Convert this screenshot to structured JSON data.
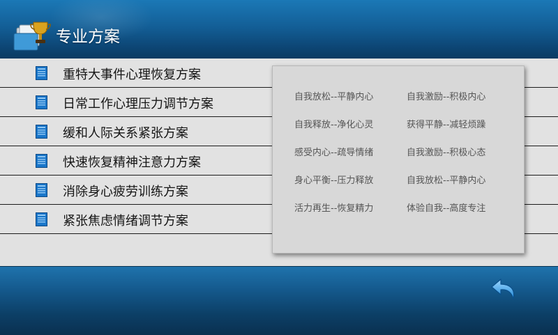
{
  "header": {
    "title": "专业方案",
    "icon": "trophy-folder-icon"
  },
  "plans": [
    {
      "label": "重特大事件心理恢复方案",
      "icon": "document-icon"
    },
    {
      "label": "日常工作心理压力调节方案",
      "icon": "document-icon"
    },
    {
      "label": "缓和人际关系紧张方案",
      "icon": "document-icon"
    },
    {
      "label": "快速恢复精神注意力方案",
      "icon": "document-icon"
    },
    {
      "label": "消除身心疲劳训练方案",
      "icon": "document-icon"
    },
    {
      "label": "紧张焦虑情绪调节方案",
      "icon": "document-icon"
    }
  ],
  "submenu": [
    [
      "自我放松--平静内心",
      "自我激励--积极内心"
    ],
    [
      "自我释放--净化心灵",
      "获得平静--减轻烦躁"
    ],
    [
      "感受内心--疏导情绪",
      "自我激励--积极心态"
    ],
    [
      "身心平衡--压力释放",
      "自我放松--平静内心"
    ],
    [
      "活力再生--恢复精力",
      "体验自我--高度专注"
    ]
  ],
  "footer": {
    "back_icon": "back-arrow-icon"
  },
  "colors": {
    "header_blue": "#135f97",
    "list_bg": "#e2e2e2",
    "icon_blue": "#1a76c9"
  }
}
